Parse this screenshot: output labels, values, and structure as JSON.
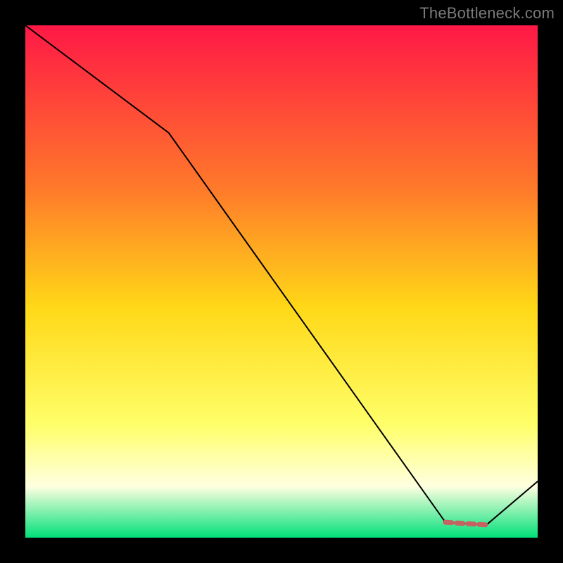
{
  "watermark": "TheBottleneck.com",
  "colors": {
    "gradient_top": "#ff1846",
    "gradient_mid_upper": "#ff7a2a",
    "gradient_mid": "#ffd817",
    "gradient_lower": "#ffff6a",
    "gradient_cream": "#ffffe0",
    "gradient_green": "#00e07a",
    "line": "#000000",
    "dash": "#c86262",
    "frame_bg": "#000000"
  },
  "chart_data": {
    "type": "line",
    "title": "",
    "xlabel": "",
    "ylabel": "",
    "xlim": [
      0,
      100
    ],
    "ylim": [
      0,
      100
    ],
    "series": [
      {
        "name": "main-curve",
        "x": [
          0,
          28,
          82,
          90,
          100
        ],
        "y": [
          100,
          79,
          3,
          2.5,
          11
        ]
      }
    ],
    "dash_segment": {
      "x": [
        82,
        90
      ],
      "y": [
        3,
        2.5
      ]
    }
  }
}
